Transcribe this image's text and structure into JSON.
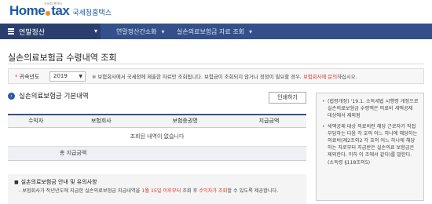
{
  "header": {
    "logo_main": "Home",
    "logo_suffix": "tax",
    "logo_small": "국세청 홈택스",
    "org_name": "국세청홈택스"
  },
  "nav": {
    "home_label": "연말정산",
    "breadcrumbs": [
      "연말정산간소화",
      "실손의료보험금 자료 조회"
    ]
  },
  "page": {
    "title": "실손의료보험금 수령내역 조회"
  },
  "filter": {
    "label": "귀속년도",
    "year": "2019",
    "note_prefix": "※ 보험회사에서 국세청에 제출한 자료만 조회됩니다. 보험금이 조회되지 않거나 정정이 필요할 경우, ",
    "note_highlight": "보험회사에 문의",
    "note_suffix": "하십시오."
  },
  "section": {
    "title": "실손의료보험금 기본내역",
    "print_label": "인쇄하기"
  },
  "table": {
    "headers": [
      "수익자",
      "보험회사",
      "보험증권명",
      "지급금액"
    ],
    "empty_message": "조회된 내역이 없습니다",
    "total_label": "총 지급금액"
  },
  "side_notes": [
    "(법령개정) '19.1. 소득세법 시행령 개정으로 실손의료보험금 수령액은 의료비 세액공제 대상에서 제외됨",
    "세액공제 대상 의료비란 해당 근로자가 직접 부담하는 다음 각 호의 어느 하나에 해당하는 의료비(제2조의2 각 호의 어느 하나에 해당하는 자로부터 지급받은 실손의료 보험금은 제외한다. 이하 이 조에서 같다)를 말한다. (소득령 §118조의5)"
  ],
  "guide": {
    "title": "실손의료보험금 안내 및 유의사항",
    "text_prefix": "- 보험회사가 작년년도에 지급한 실손의료보험금 지급내역을 ",
    "text_highlight_1": "1월 15일 이후부터",
    "text_middle": " 조회 후 ",
    "text_highlight_2": "수익자가 조회",
    "text_suffix": "할 수 있도록 제공합니다."
  }
}
